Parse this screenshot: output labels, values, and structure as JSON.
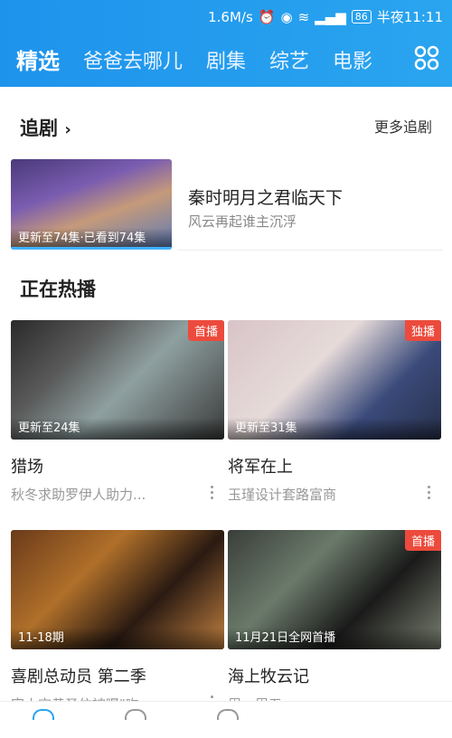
{
  "status": {
    "speed": "1.6M/s",
    "battery": "86",
    "time": "半夜11:11"
  },
  "tabs": [
    "精选",
    "爸爸去哪儿",
    "剧集",
    "综艺",
    "电影"
  ],
  "following": {
    "title": "追剧",
    "more": "更多追剧",
    "item": {
      "overlay": "更新至74集·已看到74集",
      "name": "秦时明月之君临天下",
      "desc": "风云再起谁主沉浮"
    }
  },
  "hot": {
    "title": "正在热播",
    "cards": [
      {
        "badge": "首播",
        "overlay": "更新至24集",
        "title": "猎场",
        "sub": "秋冬求助罗伊人助力..."
      },
      {
        "badge": "独播",
        "overlay": "更新至31集",
        "title": "将军在上",
        "sub": "玉瑾设计套路富商"
      },
      {
        "badge": "",
        "overlay": "11-18期",
        "title": "喜剧总动员 第二季",
        "sub": "宋小宝黄圣依被曝\"吻"
      },
      {
        "badge": "首播",
        "overlay": "11月21日全网首播",
        "title": "海上牧云记",
        "sub": "周一周五"
      }
    ]
  }
}
